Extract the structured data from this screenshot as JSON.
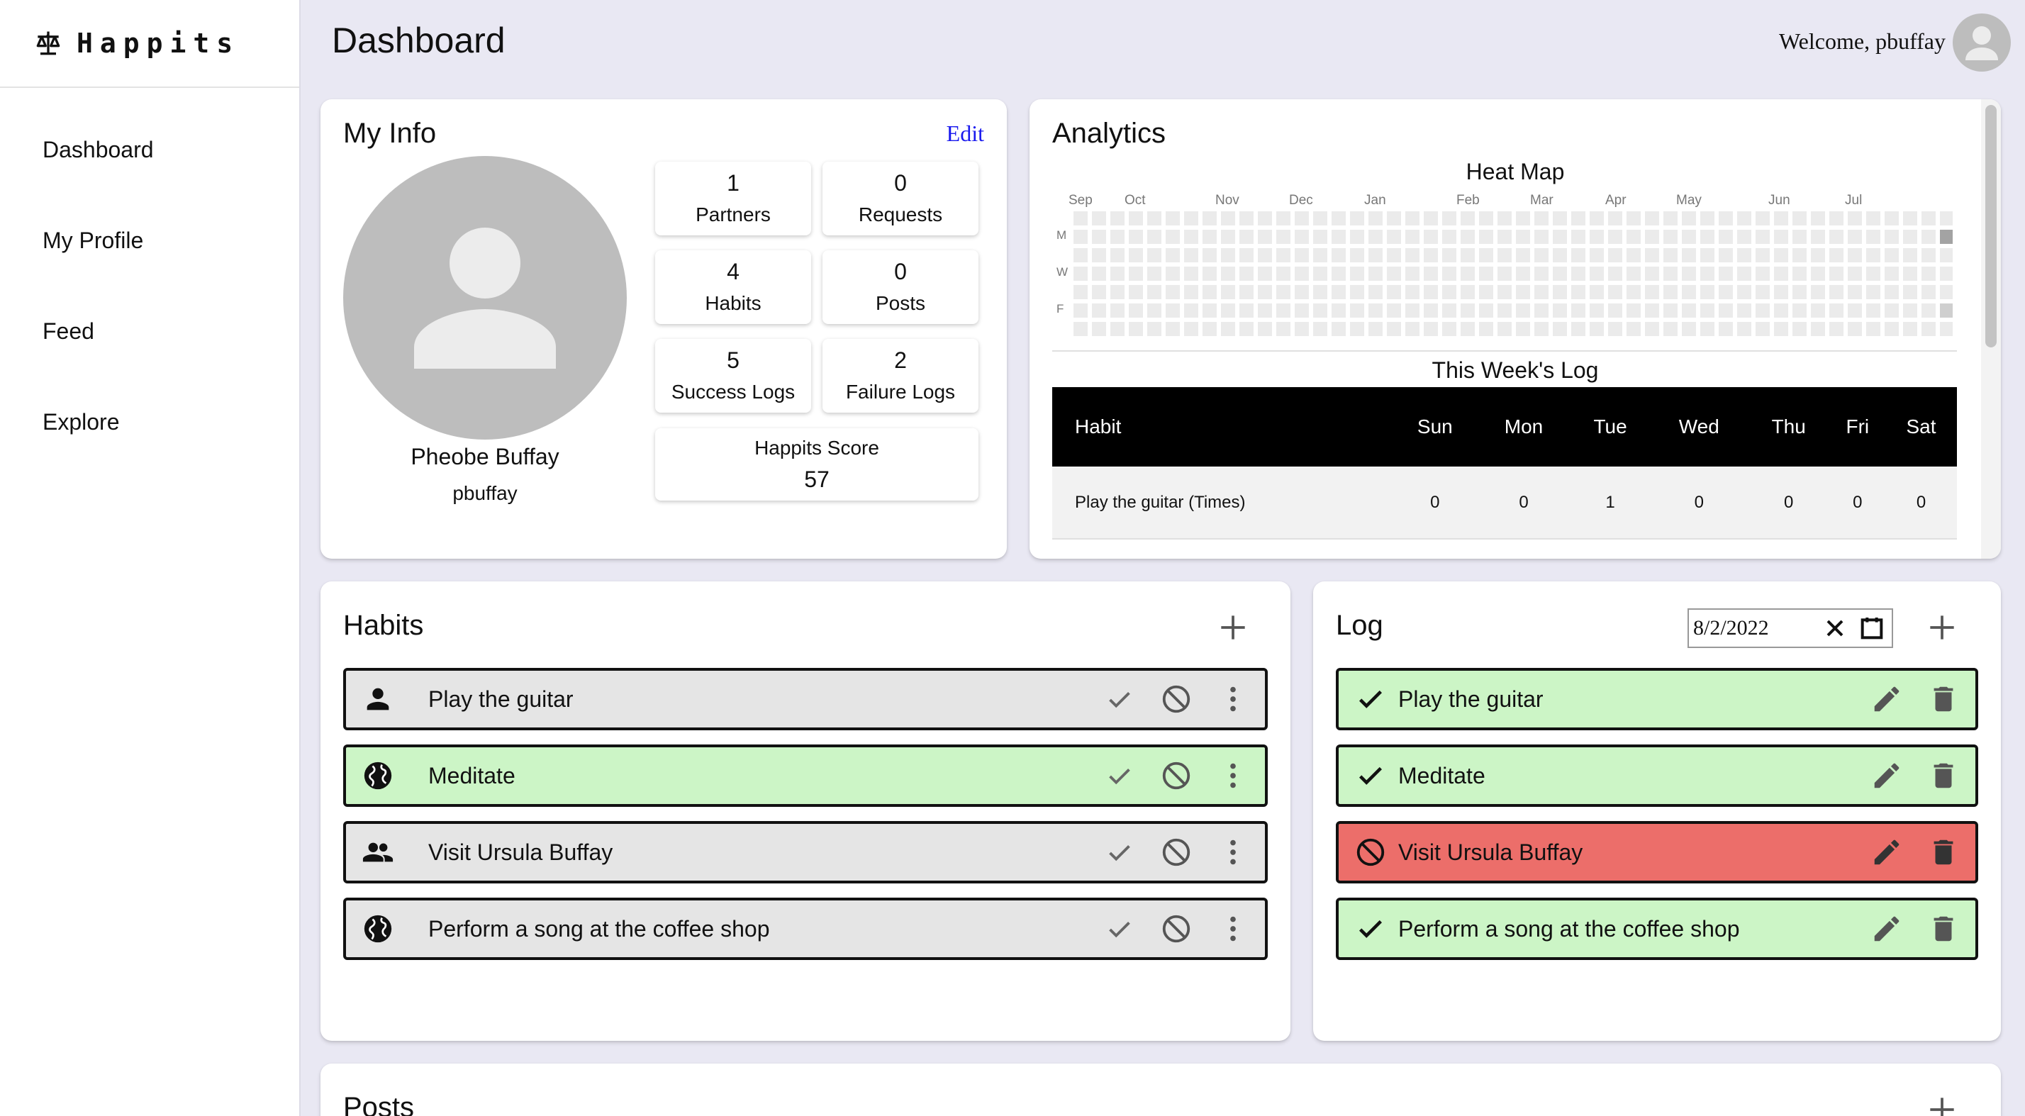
{
  "brand": {
    "name": "Happits"
  },
  "nav": {
    "items": [
      {
        "label": "Dashboard"
      },
      {
        "label": "My Profile"
      },
      {
        "label": "Feed"
      },
      {
        "label": "Explore"
      }
    ]
  },
  "header": {
    "title": "Dashboard",
    "welcome": "Welcome, pbuffay"
  },
  "my_info": {
    "title": "My Info",
    "edit_label": "Edit",
    "name": "Pheobe Buffay",
    "username": "pbuffay",
    "stats": [
      {
        "value": "1",
        "label": "Partners"
      },
      {
        "value": "0",
        "label": "Requests"
      },
      {
        "value": "4",
        "label": "Habits"
      },
      {
        "value": "0",
        "label": "Posts"
      },
      {
        "value": "5",
        "label": "Success Logs"
      },
      {
        "value": "2",
        "label": "Failure Logs"
      }
    ],
    "score": {
      "label": "Happits Score",
      "value": "57"
    }
  },
  "analytics": {
    "title": "Analytics",
    "heatmap": {
      "title": "Heat Map",
      "months": [
        "Sep",
        "Oct",
        "Nov",
        "Dec",
        "Jan",
        "Feb",
        "Mar",
        "Apr",
        "May",
        "Jun",
        "Jul"
      ],
      "day_labels": [
        "M",
        "W",
        "F"
      ],
      "weeks": 48,
      "highlighted": [
        {
          "week": 47,
          "day": 1,
          "level": "dark"
        },
        {
          "week": 47,
          "day": 5,
          "level": "light"
        }
      ],
      "colors": {
        "empty": "#ebebeb",
        "dark": "#a3a3a3",
        "light": "#cfcfcf"
      }
    },
    "week_log": {
      "title": "This Week's Log",
      "columns": [
        "Habit",
        "Sun",
        "Mon",
        "Tue",
        "Wed",
        "Thu",
        "Fri",
        "Sat"
      ],
      "rows": [
        {
          "habit": "Play the guitar (Times)",
          "values": [
            "0",
            "0",
            "1",
            "0",
            "0",
            "0",
            "0"
          ]
        }
      ]
    }
  },
  "habits": {
    "title": "Habits",
    "items": [
      {
        "label": "Play the guitar",
        "icon": "person-icon",
        "state": "grey"
      },
      {
        "label": "Meditate",
        "icon": "globe-icon",
        "state": "green"
      },
      {
        "label": "Visit Ursula Buffay",
        "icon": "people-icon",
        "state": "grey"
      },
      {
        "label": "Perform a song at the coffee shop",
        "icon": "globe-icon",
        "state": "grey"
      }
    ]
  },
  "log": {
    "title": "Log",
    "date": "8/2/2022",
    "items": [
      {
        "label": "Play the guitar",
        "status": "success"
      },
      {
        "label": "Meditate",
        "status": "success"
      },
      {
        "label": "Visit Ursula Buffay",
        "status": "failure"
      },
      {
        "label": "Perform a song at the coffee shop",
        "status": "success"
      }
    ]
  },
  "posts": {
    "title": "Posts"
  },
  "colors": {
    "background": "#e9e8f3",
    "success": "#ccf5c6",
    "failure": "#ec6e6a",
    "neutral": "#e5e5e5",
    "link": "#1a1aee"
  }
}
